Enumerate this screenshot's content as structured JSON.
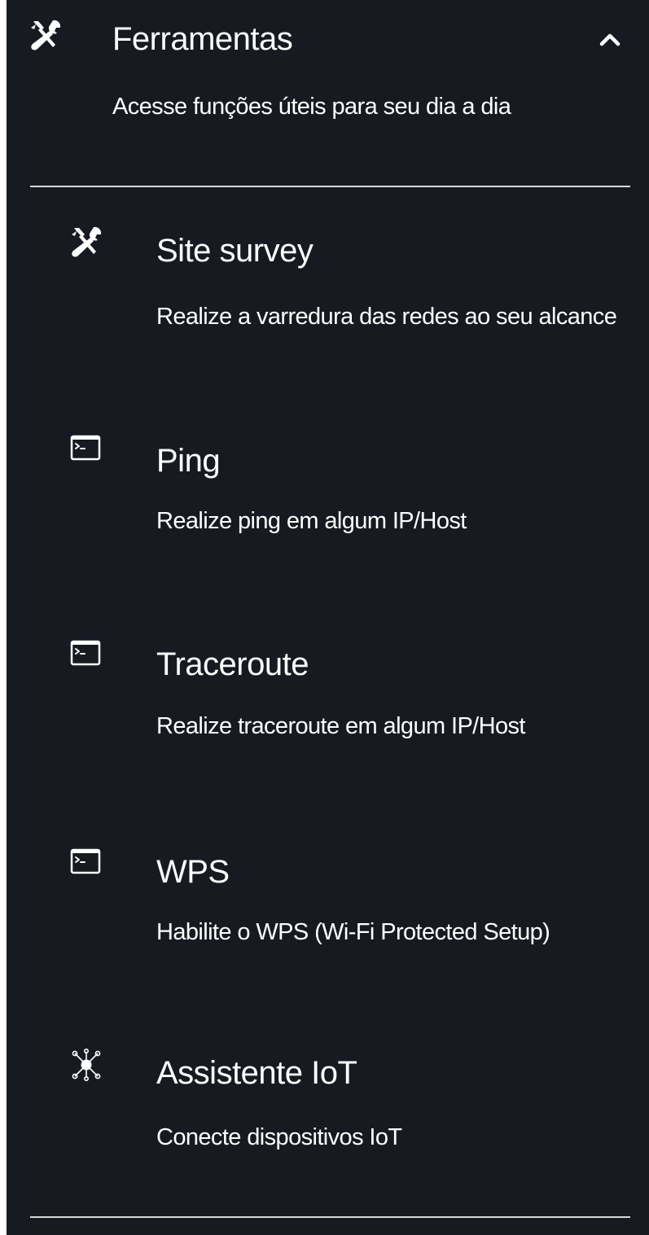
{
  "section": {
    "title": "Ferramentas",
    "description": "Acesse funções úteis para seu dia a dia",
    "icon": "tools-icon",
    "expanded": true
  },
  "items": [
    {
      "title": "Site survey",
      "description": "Realize a varredura das redes ao seu alcance",
      "icon": "tools-icon"
    },
    {
      "title": "Ping",
      "description": "Realize ping em algum IP/Host",
      "icon": "terminal-icon"
    },
    {
      "title": "Traceroute",
      "description": "Realize traceroute em algum IP/Host",
      "icon": "terminal-icon"
    },
    {
      "title": "WPS",
      "description": "Habilite o WPS (Wi-Fi Protected Setup)",
      "icon": "terminal-icon"
    },
    {
      "title": "Assistente IoT",
      "description": "Conecte dispositivos IoT",
      "icon": "network-hub-icon"
    }
  ],
  "colors": {
    "background": "#181a22",
    "text": "#ffffff",
    "divider": "#d8d8d8"
  }
}
